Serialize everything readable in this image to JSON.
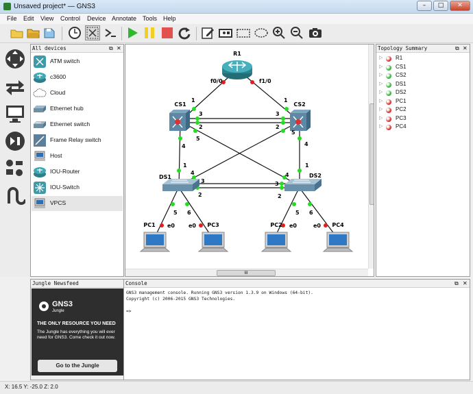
{
  "window": {
    "title": "Unsaved project* — GNS3",
    "min": "–",
    "max": "□",
    "close": "✕"
  },
  "menu": [
    "File",
    "Edit",
    "View",
    "Control",
    "Device",
    "Annotate",
    "Tools",
    "Help"
  ],
  "toolbar": [
    "open-folder-icon",
    "open-project-icon",
    "save-icon",
    "clock-icon",
    "snapshot-icon",
    "console-icon",
    "start-icon",
    "pause-icon",
    "stop-icon",
    "reload-icon",
    "edit-note-icon",
    "image-icon",
    "rectangle-icon",
    "ellipse-icon",
    "zoom-in-icon",
    "zoom-out-icon",
    "screenshot-icon"
  ],
  "devices_panel": {
    "title": "All devices",
    "items": [
      "ATM switch",
      "c3600",
      "Cloud",
      "Ethernet hub",
      "Ethernet switch",
      "Frame Relay switch",
      "Host",
      "IOU-Router",
      "IOU-Switch",
      "VPCS"
    ]
  },
  "topology": {
    "title": "Topology Summary",
    "items": [
      {
        "name": "R1",
        "status": "stopped"
      },
      {
        "name": "CS1",
        "status": "started"
      },
      {
        "name": "CS2",
        "status": "started"
      },
      {
        "name": "DS1",
        "status": "started"
      },
      {
        "name": "DS2",
        "status": "started"
      },
      {
        "name": "PC1",
        "status": "stopped"
      },
      {
        "name": "PC2",
        "status": "stopped"
      },
      {
        "name": "PC3",
        "status": "stopped"
      },
      {
        "name": "PC4",
        "status": "stopped"
      }
    ]
  },
  "canvas": {
    "nodes": {
      "r1": "R1",
      "cs1": "CS1",
      "cs2": "CS2",
      "ds1": "DS1",
      "ds2": "DS2",
      "pc1": "PC1",
      "pc2": "PC2",
      "pc3": "PC3",
      "pc4": "PC4"
    },
    "ports": {
      "r1_f0": "f0/0",
      "r1_f1": "f1/0",
      "cs1_1": "1",
      "cs1_3": "3",
      "cs1_2": "2",
      "cs1_4": "4",
      "cs1_5": "5",
      "cs2_1": "1",
      "cs2_3": "3",
      "cs2_2": "2",
      "cs2_4": "4",
      "cs2_5": "5",
      "ds1_1": "1",
      "ds1_4": "4",
      "ds1_3": "3",
      "ds1_2": "2",
      "ds1_5": "5",
      "ds1_6": "6",
      "ds2_1": "1",
      "ds2_4": "4",
      "ds2_3": "3",
      "ds2_2": "2",
      "ds2_5": "5",
      "ds2_6": "6",
      "pc1_e0": "e0",
      "pc3_e0": "e0",
      "pc2_e0": "e0",
      "pc4_e0": "e0"
    },
    "scroll_grip": "III"
  },
  "jungle": {
    "title": "Jungle Newsfeed",
    "brand": "GNS3",
    "brand_sub": "Jungle",
    "headline": "THE ONLY RESOURCE YOU NEED",
    "body": "The Jungle has everything you will ever need for GNS3. Come check it out now.",
    "button": "Go to the Jungle"
  },
  "console": {
    "title": "Console",
    "line1": "GNS3 management console. Running GNS3 version 1.3.9 on Windows (64-bit).",
    "line2": "Copyright (c) 2006-2015 GNS3 Technologies.",
    "prompt": "=>"
  },
  "status": "X: 16.5 Y: -25.0 Z: 2.0",
  "colors": {
    "started": "#37b237",
    "stopped": "#d93030",
    "link_up": "#22dd22",
    "link_down": "#e02020"
  }
}
